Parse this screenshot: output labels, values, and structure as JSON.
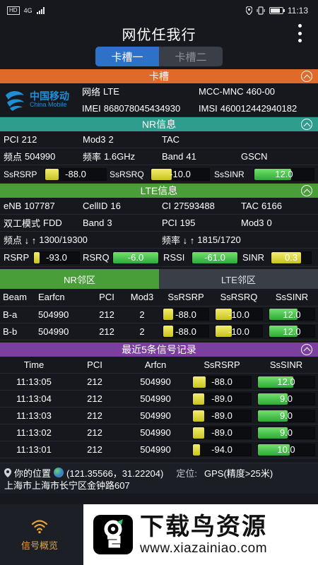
{
  "status_bar": {
    "network": "HD",
    "signal": "4G",
    "time": "11:13"
  },
  "app": {
    "title": "网优任我行"
  },
  "sim_tabs": [
    "卡槽一",
    "卡槽二"
  ],
  "sections": {
    "sim": "卡槽",
    "nr": "NR信息",
    "lte": "LTE信息",
    "history": "最近5条信号记录"
  },
  "carrier": {
    "logo_cn": "中国移动",
    "logo_en": "China Mobile",
    "network_label": "网络",
    "network": "LTE",
    "mcc_label": "MCC-MNC",
    "mcc": "460-00",
    "imei_label": "IMEI",
    "imei": "868078045434930",
    "imsi_label": "IMSI",
    "imsi": "460012442940182"
  },
  "nr": {
    "pci_label": "PCI",
    "pci": "212",
    "mod3_label": "Mod3",
    "mod3": "2",
    "tac_label": "TAC",
    "tac": "",
    "freqpt_label": "频点",
    "freqpt": "504990",
    "freq_label": "频率",
    "freq": "1.6GHz",
    "band_label": "Band",
    "band": "41",
    "gscn_label": "GSCN",
    "gscn": "",
    "ssrsrp_label": "SsRSRP",
    "ssrsrp": "-88.0",
    "ssrsrq_label": "SsRSRQ",
    "ssrsrq": "-10.0",
    "sssinr_label": "SsSINR",
    "sssinr": "12.0"
  },
  "lte": {
    "enb_label": "eNB",
    "enb": "107787",
    "cellid_label": "CellID",
    "cellid": "16",
    "ci_label": "CI",
    "ci": "27593488",
    "tac_label": "TAC",
    "tac": "6166",
    "mode_label": "双工模式",
    "mode": "FDD",
    "band_label": "Band",
    "band": "3",
    "pci_label": "PCI",
    "pci": "195",
    "mod3_label": "Mod3",
    "mod3": "0",
    "freqpt_label": "频点 ↓ ↑",
    "freqpt": "1300/19300",
    "freq_label": "频率 ↓ ↑",
    "freq": "1815/1720",
    "rsrp_label": "RSRP",
    "rsrp": "-93.0",
    "rsrq_label": "RSRQ",
    "rsrq": "-6.0",
    "rssi_label": "RSSI",
    "rssi": "-61.0",
    "sinr_label": "SINR",
    "sinr": "0.3"
  },
  "neighbor_tabs": [
    "NR邻区",
    "LTE邻区"
  ],
  "neighbor_table": {
    "headers": [
      "Beam",
      "Earfcn",
      "PCI",
      "Mod3",
      "SsRSRP",
      "SsRSRQ",
      "SsSINR"
    ],
    "rows": [
      [
        "B-a",
        "504990",
        "212",
        "2",
        "-88.0",
        "-10.0",
        "12.0"
      ],
      [
        "B-b",
        "504990",
        "212",
        "2",
        "-88.0",
        "-10.0",
        "12.0"
      ]
    ]
  },
  "history_table": {
    "headers": [
      "Time",
      "PCI",
      "Arfcn",
      "SsRSRP",
      "SsSINR"
    ],
    "rows": [
      [
        "11:13:05",
        "212",
        "504990",
        "-88.0",
        "12.0"
      ],
      [
        "11:13:04",
        "212",
        "504990",
        "-89.0",
        "9.0"
      ],
      [
        "11:13:03",
        "212",
        "504990",
        "-89.0",
        "9.0"
      ],
      [
        "11:13:02",
        "212",
        "504990",
        "-89.0",
        "9.0"
      ],
      [
        "11:13:01",
        "212",
        "504990",
        "-94.0",
        "10.0"
      ]
    ]
  },
  "location": {
    "label": "你的位置",
    "coords": "(121.35566，31.22204)",
    "positioning_label": "定位:",
    "positioning": "GPS(精度>25米)",
    "address": "上海市上海市长宁区金钟路607"
  },
  "bottom_nav": {
    "item1": "信号概览"
  },
  "watermark": {
    "brand": "下载鸟资源",
    "url": "www.xiazainiao.com"
  },
  "colors": {
    "accent_blue": "#2d71c9",
    "orange": "#e06a2a",
    "teal": "#2f9d8e",
    "green": "#4a9e3a",
    "purple": "#7b3fa0",
    "gauge_yellow": "#e6df3a",
    "gauge_green": "#4fc94a"
  }
}
